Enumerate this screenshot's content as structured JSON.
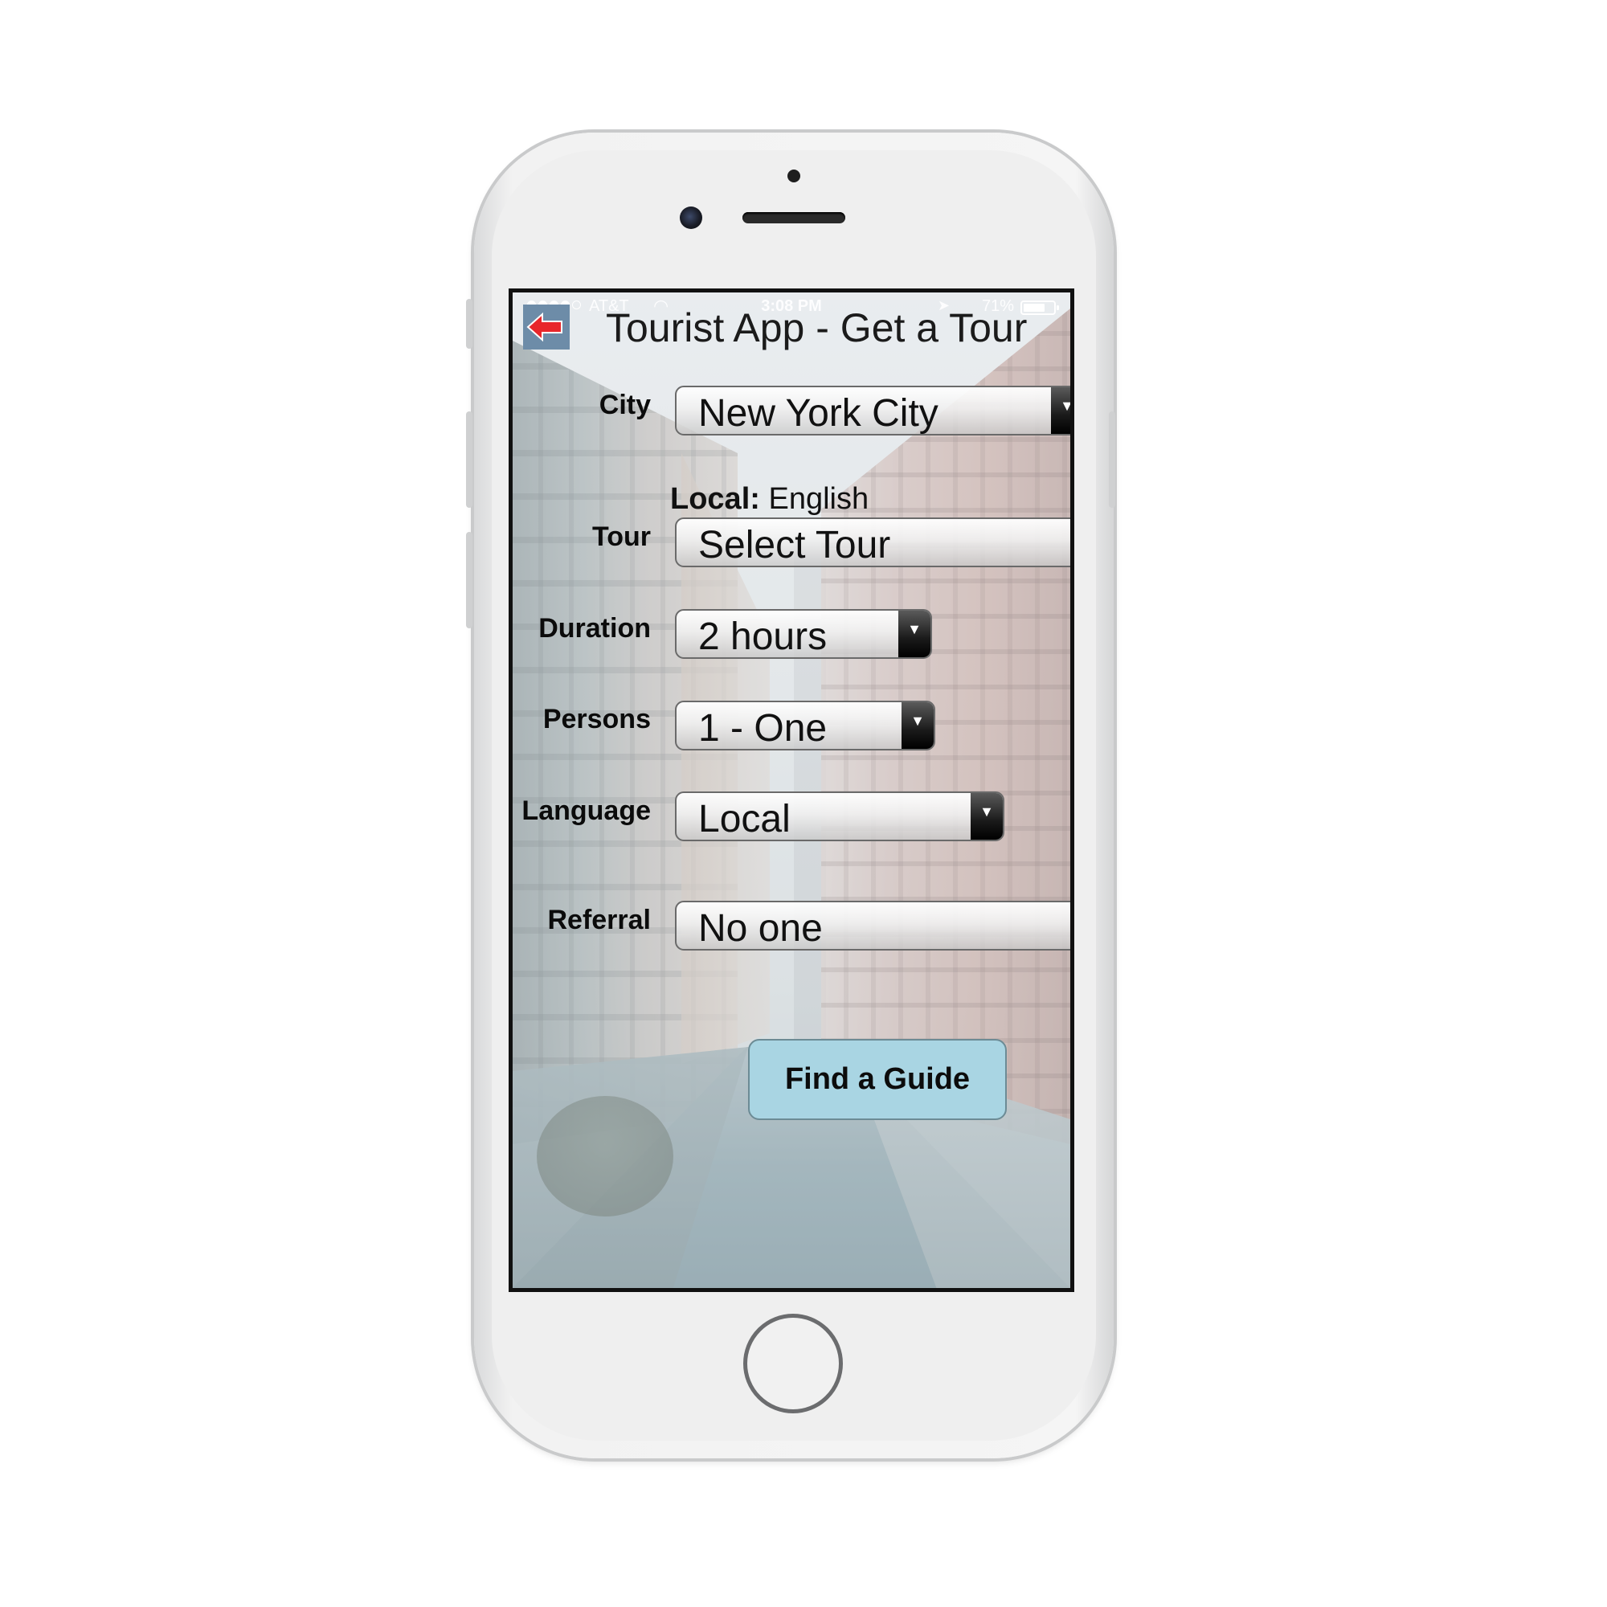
{
  "status_bar": {
    "carrier": "AT&T",
    "time": "3:08 PM",
    "battery": "71%"
  },
  "header": {
    "title": "Tourist App - Get a Tour",
    "back_icon": "back-arrow-icon",
    "back_icon_color": "#e8262b"
  },
  "form": {
    "city_label": "City",
    "city_value": "New York City",
    "local_label": "Local:",
    "local_value": "English",
    "tour_label": "Tour",
    "tour_value": "Select Tour",
    "duration_label": "Duration",
    "duration_value": "2 hours",
    "persons_label": "Persons",
    "persons_value": "1 - One",
    "language_label": "Language",
    "language_value": "Local",
    "referral_label": "Referral",
    "referral_value": "No one",
    "dropdown_icon": "dropdown-triangle-icon"
  },
  "actions": {
    "find_guide_label": "Find a Guide",
    "find_guide_color": "#a9d5e3"
  }
}
